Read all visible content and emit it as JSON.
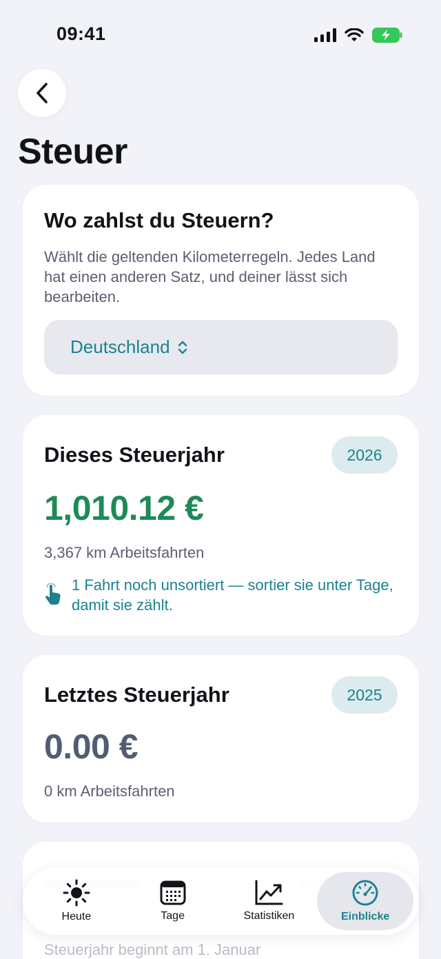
{
  "status_bar": {
    "time": "09:41"
  },
  "page": {
    "title": "Steuer"
  },
  "country_card": {
    "heading": "Wo zahlst du Steuern?",
    "description": "Wählt die geltenden Kilometerregeln. Jedes Land hat einen anderen Satz, und deiner lässt sich bearbeiten.",
    "selected_country": "Deutschland"
  },
  "this_year_card": {
    "heading": "Dieses Steuerjahr",
    "year": "2026",
    "amount": "1,010.12 €",
    "km": "3,367 km Arbeitsfahrten",
    "hint": "1 Fahrt noch unsortiert — sortier sie unter Tage, damit sie zählt."
  },
  "last_year_card": {
    "heading": "Letztes Steuerjahr",
    "year": "2025",
    "amount": "0.00 €",
    "km": "0 km Arbeitsfahrten"
  },
  "next_card": {
    "footer": "Steuerjahr beginnt am 1. Januar"
  },
  "tabs": [
    {
      "label": "Heute",
      "icon": "sun-icon"
    },
    {
      "label": "Tage",
      "icon": "calendar-icon"
    },
    {
      "label": "Statistiken",
      "icon": "chart-icon"
    },
    {
      "label": "Einblicke",
      "icon": "gauge-icon",
      "active": true
    }
  ],
  "colors": {
    "accent": "#1a8290",
    "green": "#1e8a55",
    "battery": "#34c759"
  }
}
